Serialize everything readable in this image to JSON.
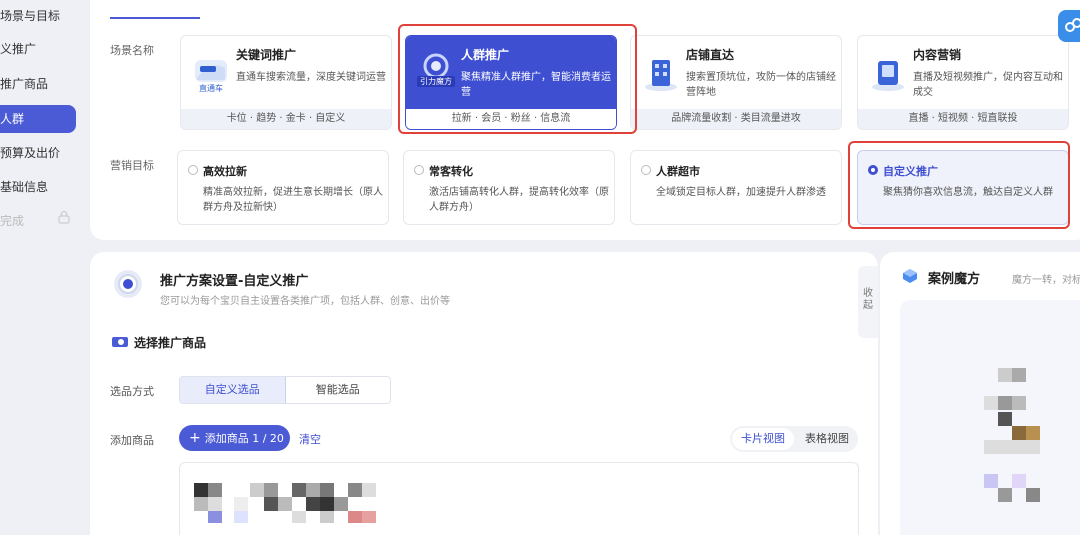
{
  "nav": {
    "items": [
      {
        "label": "场景与目标"
      },
      {
        "label": "义推广"
      },
      {
        "label": "推广商品"
      },
      {
        "label": "人群"
      },
      {
        "label": "预算及出价"
      },
      {
        "label": "基础信息"
      },
      {
        "label": "完成"
      }
    ]
  },
  "scene_section": {
    "label": "场景名称",
    "cards": [
      {
        "title": "关键词推广",
        "desc": "直通车搜索流量，深度关键词运营",
        "foot": "卡位 · 趋势 · 金卡 · 自定义",
        "icon_caption": "直通车"
      },
      {
        "title": "人群推广",
        "desc": "聚焦精准人群推广，智能消费者运营",
        "foot": "拉新 · 会员 · 粉丝 · 信息流",
        "icon_caption": "引力魔方"
      },
      {
        "title": "店铺直达",
        "desc": "搜索置顶坑位，攻防一体的店铺经营阵地",
        "foot": "品牌流量收割 · 类目流量进攻"
      },
      {
        "title": "内容营销",
        "desc": "直播及短视频推广，促内容互动和成交",
        "foot": "直播 · 短视频 · 短直联投"
      }
    ]
  },
  "goal_section": {
    "label": "营销目标",
    "cards": [
      {
        "title": "高效拉新",
        "desc": "精准高效拉新，促进生意长期增长（原人群方舟及拉新快）"
      },
      {
        "title": "常客转化",
        "desc": "激活店铺高转化人群，提高转化效率（原人群方舟）"
      },
      {
        "title": "人群超市",
        "desc": "全域锁定目标人群，加速提升人群渗透"
      },
      {
        "title": "自定义推广",
        "desc": "聚焦猜你喜欢信息流，触达自定义人群"
      }
    ]
  },
  "plan": {
    "title": "推广方案设置-自定义推广",
    "subtitle": "您可以为每个宝贝自主设置各类推广项，包括人群、创意、出价等",
    "collapse_label": "收起",
    "section_title": "选择推广商品",
    "select_mode_label": "选品方式",
    "select_modes": [
      "自定义选品",
      "智能选品"
    ],
    "add_label": "添加商品",
    "add_button": "添加商品 1 / 20",
    "clear": "清空",
    "views": [
      "卡片视图",
      "表格视图"
    ]
  },
  "case": {
    "title": "案例魔方",
    "subtitle": "魔方一转，对标"
  },
  "colors": {
    "accent": "#4b5bd6",
    "highlight_border": "#e0413a"
  }
}
